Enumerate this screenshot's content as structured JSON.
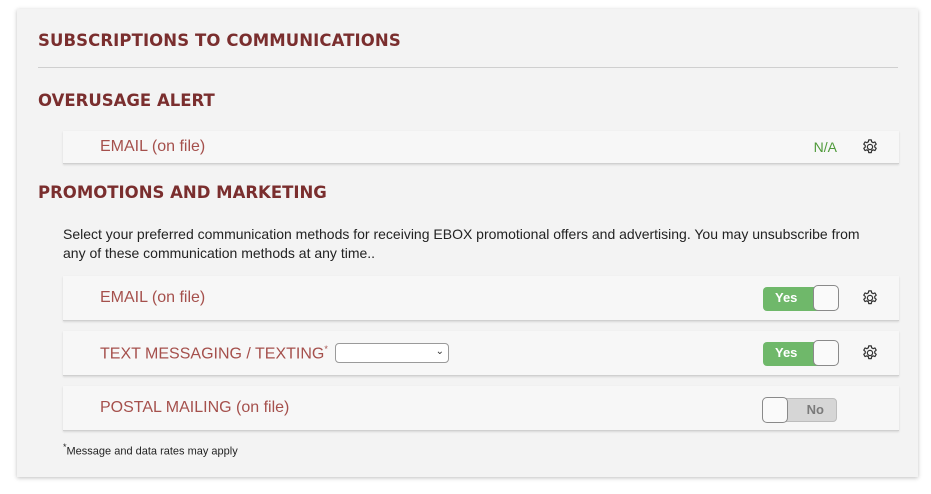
{
  "page_title": "SUBSCRIPTIONS TO COMMUNICATIONS",
  "overusage": {
    "heading": "OVERUSAGE ALERT",
    "email_label": "EMAIL (on file)",
    "email_status": "N/A"
  },
  "promotions": {
    "heading": "PROMOTIONS AND MARKETING",
    "description": "Select your preferred communication methods for receiving EBOX promotional offers and advertising. You may unsubscribe from any of these communication methods at any time..",
    "rows": [
      {
        "label": "EMAIL (on file)",
        "toggle": "Yes"
      },
      {
        "label": "TEXT MESSAGING / TEXTING",
        "marker": "*",
        "select_value": "",
        "toggle": "Yes"
      },
      {
        "label": "POSTAL MAILING (on file)",
        "toggle": "No"
      }
    ]
  },
  "footnote": {
    "marker": "*",
    "text": "Message and data rates may apply"
  },
  "colors": {
    "heading": "#7a2e2e",
    "label": "#a5504c",
    "toggle_on": "#6fb86a",
    "toggle_off": "#d6d6d6",
    "status": "#4f9a3a"
  }
}
